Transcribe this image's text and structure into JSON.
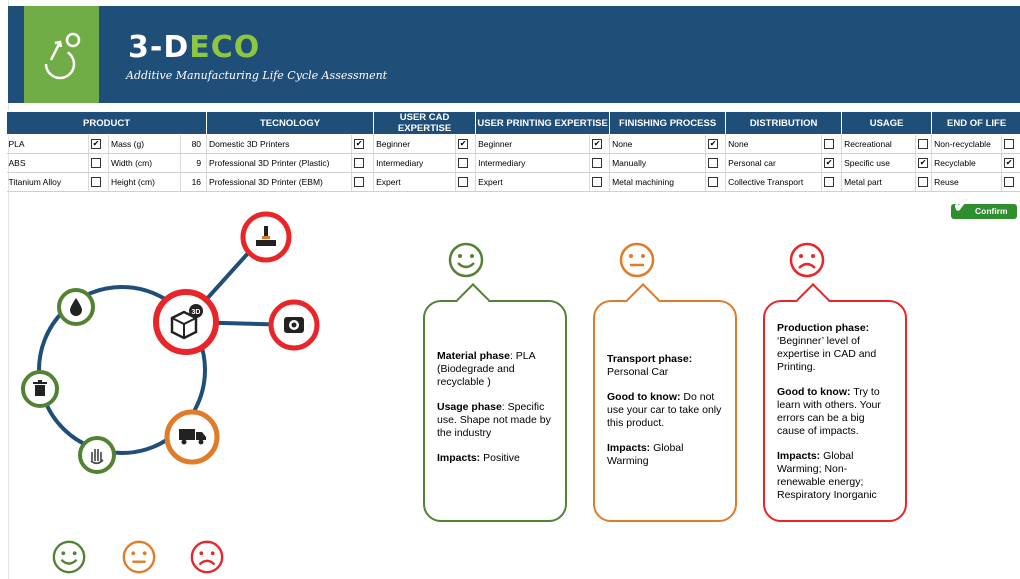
{
  "header": {
    "brand_prefix": "3-D",
    "brand_suffix": "ECO",
    "subtitle": "Additive Manufacturing Life Cycle Assessment",
    "logo_icon": "recycle-loop-icon"
  },
  "table": {
    "headers": [
      "PRODUCT",
      "TECNOLOGY",
      "USER CAD EXPERTISE",
      "USER PRINTING EXPERTISE",
      "FINISHING PROCESS",
      "DISTRIBUTION",
      "USAGE",
      "END OF LIFE"
    ],
    "rows": [
      {
        "material": "PLA",
        "material_checked": true,
        "dim_label": "Mass (g)",
        "dim_value": "80",
        "tech": "Domestic 3D Printers",
        "tech_checked": true,
        "cad": "Beginner",
        "cad_checked": true,
        "print": "Beginner",
        "print_checked": true,
        "finish": "None",
        "finish_checked": true,
        "dist": "None",
        "dist_checked": false,
        "usage": "Recreational",
        "usage_checked": false,
        "eol": "Non-recyclable",
        "eol_checked": false
      },
      {
        "material": "ABS",
        "material_checked": false,
        "dim_label": "Width (cm)",
        "dim_value": "9",
        "tech": "Professional 3D Printer (Plastic)",
        "tech_checked": false,
        "cad": "Intermediary",
        "cad_checked": false,
        "print": "Intermediary",
        "print_checked": false,
        "finish": "Manually",
        "finish_checked": false,
        "dist": "Personal car",
        "dist_checked": true,
        "usage": "Specific use",
        "usage_checked": true,
        "eol": "Recyclable",
        "eol_checked": true
      },
      {
        "material": "Titanium Alloy",
        "material_checked": false,
        "dim_label": "Height (cm)",
        "dim_value": "16",
        "tech": "Professional 3D Printer (EBM)",
        "tech_checked": false,
        "cad": "Expert",
        "cad_checked": false,
        "print": "Expert",
        "print_checked": false,
        "finish": "Metal machining",
        "finish_checked": false,
        "dist": "Collective Transport",
        "dist_checked": false,
        "usage": "Metal part",
        "usage_checked": false,
        "eol": "Reuse",
        "eol_checked": false
      }
    ]
  },
  "confirm": {
    "label": "Confirm",
    "icon": "checkmark-icon"
  },
  "diagram": {
    "center_icon": "3d-cube-icon",
    "nodes": [
      {
        "name": "material",
        "icon": "drop-icon",
        "color": "#548235"
      },
      {
        "name": "end-of-life",
        "icon": "trash-icon",
        "color": "#548235"
      },
      {
        "name": "usage",
        "icon": "hand-icon",
        "color": "#548235"
      },
      {
        "name": "distribution",
        "icon": "truck-icon",
        "color": "#e07b28"
      },
      {
        "name": "finishing",
        "icon": "machining-icon",
        "color": "#e8262a"
      },
      {
        "name": "design",
        "icon": "cad-screen-icon",
        "color": "#e8262a"
      }
    ]
  },
  "colors": {
    "positive": "#548235",
    "neutral": "#e07b28",
    "negative": "#e8262a",
    "header": "#1f4e79",
    "logo_bg": "#70ad47"
  },
  "bubbles": {
    "green": {
      "p1_bold": "Material phase",
      "p1_text": ": PLA (Biodegrade and recyclable )",
      "p2_bold": "Usage phase",
      "p2_text": ": Specific use. Shape not made by the industry",
      "p3_bold": "Impacts:",
      "p3_text": " Positive"
    },
    "orange": {
      "p1_bold": "Transport phase:",
      "p1_text": "Personal Car",
      "p2_bold": "Good to know:",
      "p2_text": " Do not use your car to take only this product.",
      "p3_bold": "Impacts:",
      "p3_text": " Global Warming"
    },
    "red": {
      "p1_bold": "Production phase:",
      "p1_text": "‘Beginner’ level of expertise in CAD and Printing.",
      "p2_bold": "Good to know:",
      "p2_text": " Try to learn with others. Your errors can be a big cause of impacts.",
      "p3_bold": "Impacts:",
      "p3_text": " Global Warming; Non-renewable energy; Respiratory Inorganic"
    }
  }
}
